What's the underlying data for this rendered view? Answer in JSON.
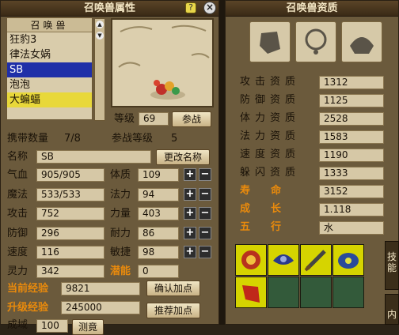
{
  "left_panel": {
    "title": "召唤兽属性",
    "help": "?",
    "close": "×",
    "list_header": "召唤兽",
    "pets": [
      "狂豹3",
      "律法女娲",
      "SB",
      "泡泡",
      "大蝙蝠"
    ],
    "level_label": "等级",
    "level_value": "69",
    "battle_button": "参战",
    "carry_label": "携带数量",
    "carry_value": "7/8",
    "battle_level_label": "参战等级",
    "battle_level_value": "5",
    "name_label": "名称",
    "name_value": "SB",
    "rename_button": "更改名称",
    "stats_left": [
      {
        "label": "气血",
        "value": "905/905"
      },
      {
        "label": "魔法",
        "value": "533/533"
      },
      {
        "label": "攻击",
        "value": "752"
      },
      {
        "label": "防御",
        "value": "296"
      },
      {
        "label": "速度",
        "value": "116"
      },
      {
        "label": "灵力",
        "value": "342"
      }
    ],
    "stats_right": [
      {
        "label": "体质",
        "value": "109"
      },
      {
        "label": "法力",
        "value": "94"
      },
      {
        "label": "力量",
        "value": "403"
      },
      {
        "label": "耐力",
        "value": "86"
      },
      {
        "label": "敏捷",
        "value": "98"
      }
    ],
    "potential_label": "潜能",
    "potential_value": "0",
    "plus": "+",
    "minus": "−",
    "exp_label": "当前经验",
    "exp_value": "9821",
    "confirm_button": "确认加点",
    "upexp_label": "升级经验",
    "upexp_value": "245000",
    "recommend_button": "推荐加点",
    "bottom_partial_label": "成域",
    "bottom_partial_value": "100",
    "bottom_partial_button": "测竟"
  },
  "right_panel": {
    "title": "召唤兽资质",
    "aptitudes": [
      {
        "label": "攻击资质",
        "value": "1312"
      },
      {
        "label": "防御资质",
        "value": "1125"
      },
      {
        "label": "体力资质",
        "value": "2528"
      },
      {
        "label": "法力资质",
        "value": "1583"
      },
      {
        "label": "速度资质",
        "value": "1190"
      },
      {
        "label": "躲闪资质",
        "value": "1333"
      }
    ],
    "lifespan_label": "寿　　命",
    "lifespan_value": "3152",
    "growth_label": "成　　长",
    "growth_value": "1.118",
    "element_label": "五　　行",
    "element_value": "水",
    "side_tab_1": "技能",
    "side_tab_2": "内"
  },
  "colors": {
    "accent_orange": "#e98a0c",
    "select_blue": "#1f2fa8",
    "select_yellow": "#e8d83a",
    "slot_green": "#335a3a",
    "slot_yellow": "#d6d400"
  }
}
